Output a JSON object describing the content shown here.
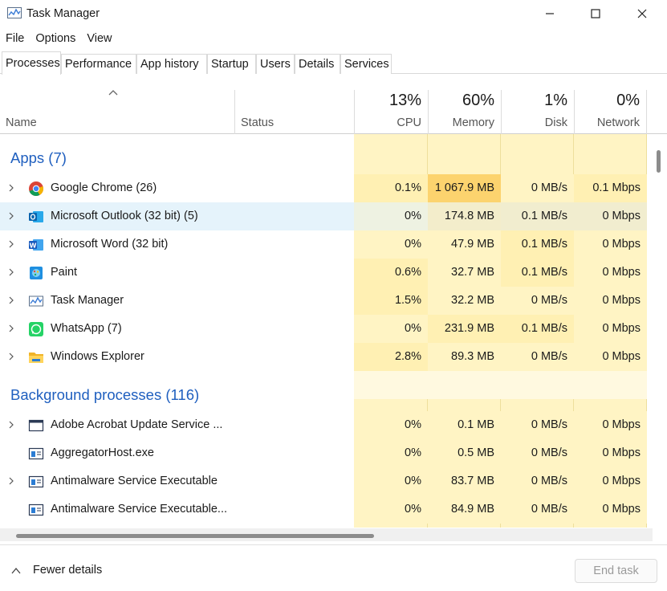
{
  "window": {
    "title": "Task Manager"
  },
  "menu": [
    "File",
    "Options",
    "View"
  ],
  "tabs": [
    "Processes",
    "Performance",
    "App history",
    "Startup",
    "Users",
    "Details",
    "Services"
  ],
  "columns": {
    "name": "Name",
    "status": "Status",
    "cpu": {
      "pct": "13%",
      "label": "CPU"
    },
    "memory": {
      "pct": "60%",
      "label": "Memory"
    },
    "disk": {
      "pct": "1%",
      "label": "Disk"
    },
    "network": {
      "pct": "0%",
      "label": "Network"
    }
  },
  "groups": {
    "apps": "Apps (7)",
    "background": "Background processes (116)"
  },
  "apps": [
    {
      "name": "Google Chrome (26)",
      "icon": "chrome-icon",
      "cpu": "0.1%",
      "memory": "1 067.9 MB",
      "disk": "0 MB/s",
      "network": "0.1 Mbps"
    },
    {
      "name": "Microsoft Outlook (32 bit) (5)",
      "icon": "outlook-icon",
      "cpu": "0%",
      "memory": "174.8 MB",
      "disk": "0.1 MB/s",
      "network": "0 Mbps"
    },
    {
      "name": "Microsoft Word (32 bit)",
      "icon": "word-icon",
      "cpu": "0%",
      "memory": "47.9 MB",
      "disk": "0.1 MB/s",
      "network": "0 Mbps"
    },
    {
      "name": "Paint",
      "icon": "paint-icon",
      "cpu": "0.6%",
      "memory": "32.7 MB",
      "disk": "0.1 MB/s",
      "network": "0 Mbps"
    },
    {
      "name": "Task Manager",
      "icon": "task-manager-icon",
      "cpu": "1.5%",
      "memory": "32.2 MB",
      "disk": "0 MB/s",
      "network": "0 Mbps"
    },
    {
      "name": "WhatsApp (7)",
      "icon": "whatsapp-icon",
      "cpu": "0%",
      "memory": "231.9 MB",
      "disk": "0.1 MB/s",
      "network": "0 Mbps"
    },
    {
      "name": "Windows Explorer",
      "icon": "folder-icon",
      "cpu": "2.8%",
      "memory": "89.3 MB",
      "disk": "0 MB/s",
      "network": "0 Mbps"
    }
  ],
  "background": [
    {
      "name": "Adobe Acrobat Update Service ...",
      "icon": "service-window-icon",
      "cpu": "0%",
      "memory": "0.1 MB",
      "disk": "0 MB/s",
      "network": "0 Mbps"
    },
    {
      "name": "AggregatorHost.exe",
      "icon": "process-icon",
      "cpu": "0%",
      "memory": "0.5 MB",
      "disk": "0 MB/s",
      "network": "0 Mbps"
    },
    {
      "name": "Antimalware Service Executable",
      "icon": "process-icon",
      "cpu": "0%",
      "memory": "83.7 MB",
      "disk": "0 MB/s",
      "network": "0 Mbps"
    },
    {
      "name": "Antimalware Service Executable...",
      "icon": "process-icon",
      "cpu": "0%",
      "memory": "84.9 MB",
      "disk": "0 MB/s",
      "network": "0 Mbps"
    }
  ],
  "footer": {
    "fewer_details": "Fewer details",
    "end_task": "End task"
  }
}
